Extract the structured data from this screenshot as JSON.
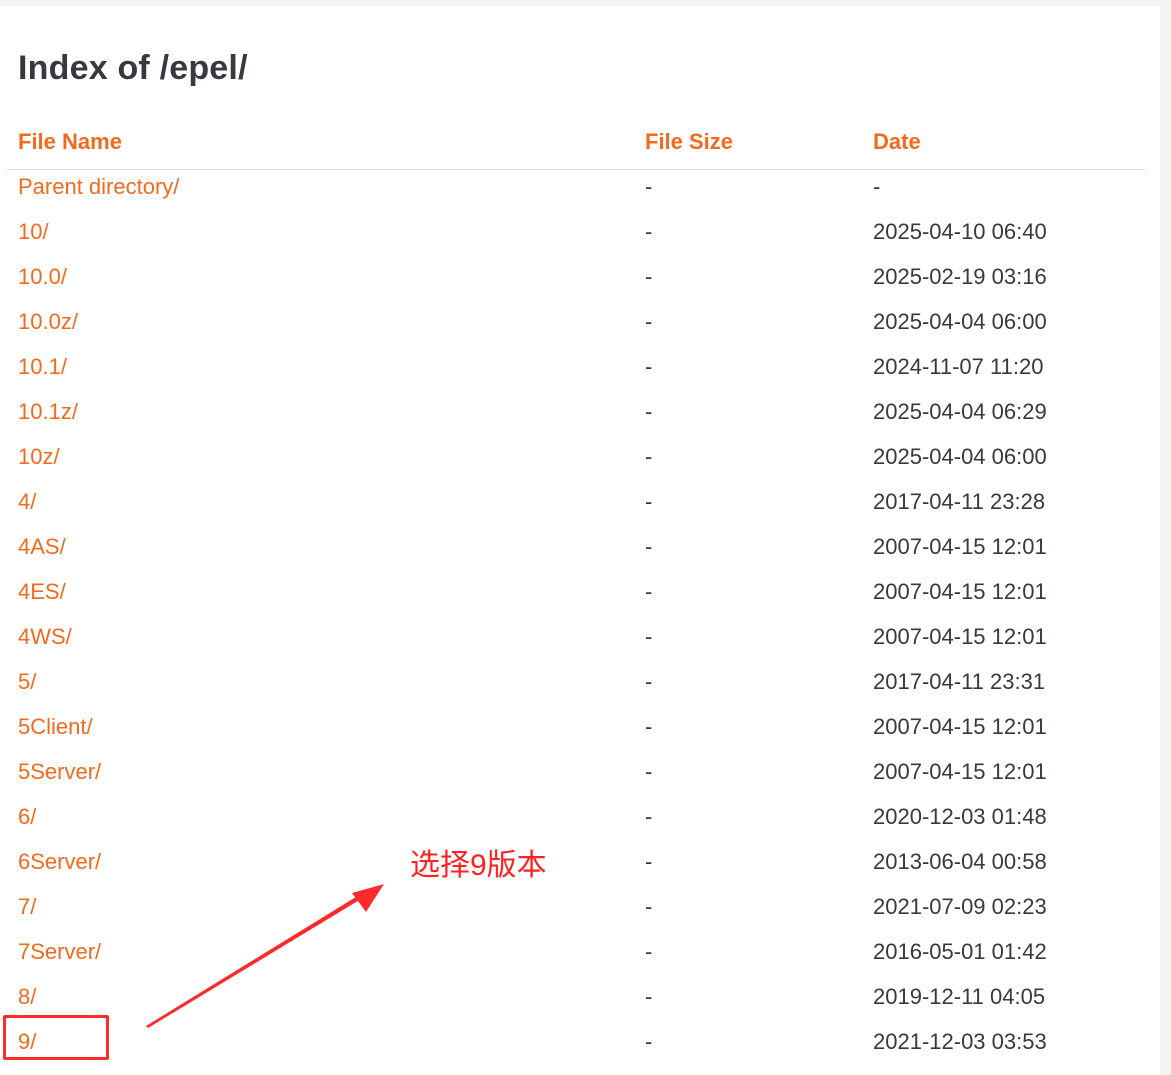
{
  "title": "Index of /epel/",
  "columns": {
    "name": "File Name",
    "size": "File Size",
    "date": "Date"
  },
  "rows": [
    {
      "name": "Parent directory/",
      "size": "-",
      "date": "-"
    },
    {
      "name": "10/",
      "size": "-",
      "date": "2025-04-10 06:40"
    },
    {
      "name": "10.0/",
      "size": "-",
      "date": "2025-02-19 03:16"
    },
    {
      "name": "10.0z/",
      "size": "-",
      "date": "2025-04-04 06:00"
    },
    {
      "name": "10.1/",
      "size": "-",
      "date": "2024-11-07 11:20"
    },
    {
      "name": "10.1z/",
      "size": "-",
      "date": "2025-04-04 06:29"
    },
    {
      "name": "10z/",
      "size": "-",
      "date": "2025-04-04 06:00"
    },
    {
      "name": "4/",
      "size": "-",
      "date": "2017-04-11 23:28"
    },
    {
      "name": "4AS/",
      "size": "-",
      "date": "2007-04-15 12:01"
    },
    {
      "name": "4ES/",
      "size": "-",
      "date": "2007-04-15 12:01"
    },
    {
      "name": "4WS/",
      "size": "-",
      "date": "2007-04-15 12:01"
    },
    {
      "name": "5/",
      "size": "-",
      "date": "2017-04-11 23:31"
    },
    {
      "name": "5Client/",
      "size": "-",
      "date": "2007-04-15 12:01"
    },
    {
      "name": "5Server/",
      "size": "-",
      "date": "2007-04-15 12:01"
    },
    {
      "name": "6/",
      "size": "-",
      "date": "2020-12-03 01:48"
    },
    {
      "name": "6Server/",
      "size": "-",
      "date": "2013-06-04 00:58"
    },
    {
      "name": "7/",
      "size": "-",
      "date": "2021-07-09 02:23"
    },
    {
      "name": "7Server/",
      "size": "-",
      "date": "2016-05-01 01:42"
    },
    {
      "name": "8/",
      "size": "-",
      "date": "2019-12-11 04:05"
    },
    {
      "name": "9/",
      "size": "-",
      "date": "2021-12-03 03:53"
    }
  ],
  "annotation": {
    "text": "选择9版本",
    "color": "#ff2222"
  },
  "colors": {
    "link": "#f46a1d",
    "text": "#343a40"
  }
}
